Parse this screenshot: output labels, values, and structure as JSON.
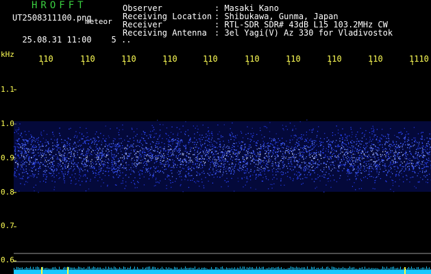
{
  "app_title": "HROFFT",
  "file_name": "UT2508311100.png",
  "mode_label": "meteor",
  "date_time": "25.08.31 11:00",
  "interval": "5",
  "info": [
    {
      "label": "Observer",
      "value": ": Masaki Kano"
    },
    {
      "label": "Receiving Location",
      "value": ": Shibukawa, Gunma, Japan"
    },
    {
      "label": "Receiver",
      "value": ": RTL-SDR SDR# 43dB L15 103.2MHz CW"
    },
    {
      "label": "Receiving Antenna",
      "value": ": 3el Yagi(V) Az 330 for Vladivostok"
    }
  ],
  "colors": {
    "text": "#ffffff",
    "axis": "#ffff55",
    "title": "#3ad040",
    "signal": "#2a3cff",
    "bottom_bar": "#19c8ff"
  },
  "chart_data": {
    "type": "heatmap",
    "y_unit": "kHz",
    "x_ticks": [
      "110",
      "110",
      "110",
      "110",
      "110",
      "110",
      "110",
      "110",
      "110",
      "1110"
    ],
    "y_ticks": [
      "1.1",
      "1.0",
      "0.9",
      "0.8",
      "0.7",
      "0.6"
    ],
    "ylim": [
      0.57,
      1.13
    ],
    "noise_band_khz": [
      0.79,
      1.02
    ],
    "noise_center_khz": 0.905
  }
}
